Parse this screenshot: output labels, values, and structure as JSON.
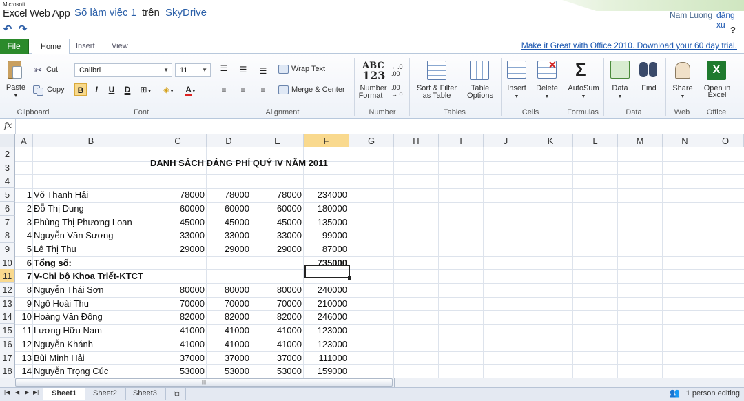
{
  "titlebar": {
    "ms": "Microsoft",
    "app": "Excel Web App",
    "workbook": "Sổ làm việc 1",
    "on": "trên",
    "service": "SkyDrive",
    "user": "Nam Luong",
    "signout": "đăng xu"
  },
  "qat": {
    "undo_icon": "undo-icon",
    "redo_icon": "redo-icon",
    "help": "?"
  },
  "tabs": {
    "file": "File",
    "items": [
      "Home",
      "Insert",
      "View"
    ],
    "active": "Home",
    "promo": "Make it Great with Office 2010. Download your 60 day trial."
  },
  "ribbon": {
    "clipboard": {
      "label": "Clipboard",
      "paste": "Paste",
      "cut": "Cut",
      "copy": "Copy"
    },
    "font": {
      "label": "Font",
      "name": "Calibri",
      "size": "11",
      "bold": "B",
      "italic": "I",
      "underline": "U",
      "double_underline": "D"
    },
    "alignment": {
      "label": "Alignment",
      "wrap": "Wrap Text",
      "merge": "Merge & Center"
    },
    "number": {
      "label": "Number",
      "format_line1": "Number",
      "format_line2": "Format",
      "abc": "ABC",
      "digits": "123"
    },
    "tables": {
      "label": "Tables",
      "sort_line1": "Sort & Filter",
      "sort_line2": "as Table",
      "options_line1": "Table",
      "options_line2": "Options"
    },
    "cells": {
      "label": "Cells",
      "insert": "Insert",
      "delete": "Delete"
    },
    "formulas": {
      "label": "Formulas",
      "autosum": "AutoSum"
    },
    "data": {
      "label": "Data",
      "data": "Data",
      "find": "Find"
    },
    "web": {
      "label": "Web",
      "share": "Share"
    },
    "office": {
      "label": "Office",
      "open_line1": "Open in",
      "open_line2": "Excel"
    }
  },
  "formula_bar": {
    "fx": "fx",
    "value": ""
  },
  "grid": {
    "columns": [
      "A",
      "B",
      "C",
      "D",
      "E",
      "F",
      "G",
      "H",
      "I",
      "J",
      "K",
      "L",
      "M",
      "N",
      "O"
    ],
    "selected_column": "F",
    "selected_row": "11",
    "title": "DANH SÁCH ĐẢNG PHÍ QUÝ IV NĂM 2011",
    "rows": [
      {
        "r": "2",
        "a": "",
        "b": "",
        "c": "",
        "d": "",
        "e": "",
        "f": "",
        "bold": false
      },
      {
        "r": "3",
        "a": "",
        "b": "",
        "c": "",
        "d": "",
        "e": "",
        "f": "",
        "bold": false
      },
      {
        "r": "4",
        "a": "",
        "b": "",
        "c": "",
        "d": "",
        "e": "",
        "f": "",
        "bold": false
      },
      {
        "r": "5",
        "a": "1",
        "b": "Võ Thanh Hải",
        "c": "78000",
        "d": "78000",
        "e": "78000",
        "f": "234000",
        "bold": false
      },
      {
        "r": "6",
        "a": "2",
        "b": "Đỗ Thị Dung",
        "c": "60000",
        "d": "60000",
        "e": "60000",
        "f": "180000",
        "bold": false
      },
      {
        "r": "7",
        "a": "3",
        "b": "Phùng Thị Phương Loan",
        "c": "45000",
        "d": "45000",
        "e": "45000",
        "f": "135000",
        "bold": false
      },
      {
        "r": "8",
        "a": "4",
        "b": "Nguyễn Văn Sương",
        "c": "33000",
        "d": "33000",
        "e": "33000",
        "f": "99000",
        "bold": false
      },
      {
        "r": "9",
        "a": "5",
        "b": "Lê Thị Thu",
        "c": "29000",
        "d": "29000",
        "e": "29000",
        "f": "87000",
        "bold": false
      },
      {
        "r": "10",
        "a": "6",
        "b": "Tổng số:",
        "c": "",
        "d": "",
        "e": "",
        "f": "735000",
        "bold": true
      },
      {
        "r": "11",
        "a": "7",
        "b": "V-Chi bộ Khoa Triết-KTCT",
        "c": "",
        "d": "",
        "e": "",
        "f": "",
        "bold": true
      },
      {
        "r": "12",
        "a": "8",
        "b": "Nguyễn Thái Sơn",
        "c": "80000",
        "d": "80000",
        "e": "80000",
        "f": "240000",
        "bold": false
      },
      {
        "r": "13",
        "a": "9",
        "b": "Ngô Hoài Thu",
        "c": "70000",
        "d": "70000",
        "e": "70000",
        "f": "210000",
        "bold": false
      },
      {
        "r": "14",
        "a": "10",
        "b": "Hoàng Văn Đông",
        "c": "82000",
        "d": "82000",
        "e": "82000",
        "f": "246000",
        "bold": false
      },
      {
        "r": "15",
        "a": "11",
        "b": "Lương Hữu Nam",
        "c": "41000",
        "d": "41000",
        "e": "41000",
        "f": "123000",
        "bold": false
      },
      {
        "r": "16",
        "a": "12",
        "b": "Nguyễn Khánh",
        "c": "41000",
        "d": "41000",
        "e": "41000",
        "f": "123000",
        "bold": false
      },
      {
        "r": "17",
        "a": "13",
        "b": "Bùi Minh Hải",
        "c": "37000",
        "d": "37000",
        "e": "37000",
        "f": "111000",
        "bold": false
      },
      {
        "r": "18",
        "a": "14",
        "b": "Nguyễn Trọng Cúc",
        "c": "53000",
        "d": "53000",
        "e": "53000",
        "f": "159000",
        "bold": false
      }
    ]
  },
  "sheets": {
    "items": [
      "Sheet1",
      "Sheet2",
      "Sheet3"
    ],
    "active": "Sheet1"
  },
  "status": {
    "editing": "1 person editing"
  },
  "colors": {
    "accent": "#2a5fa8",
    "file_tab": "#2b8a2b",
    "selection": "#f9d98e"
  }
}
